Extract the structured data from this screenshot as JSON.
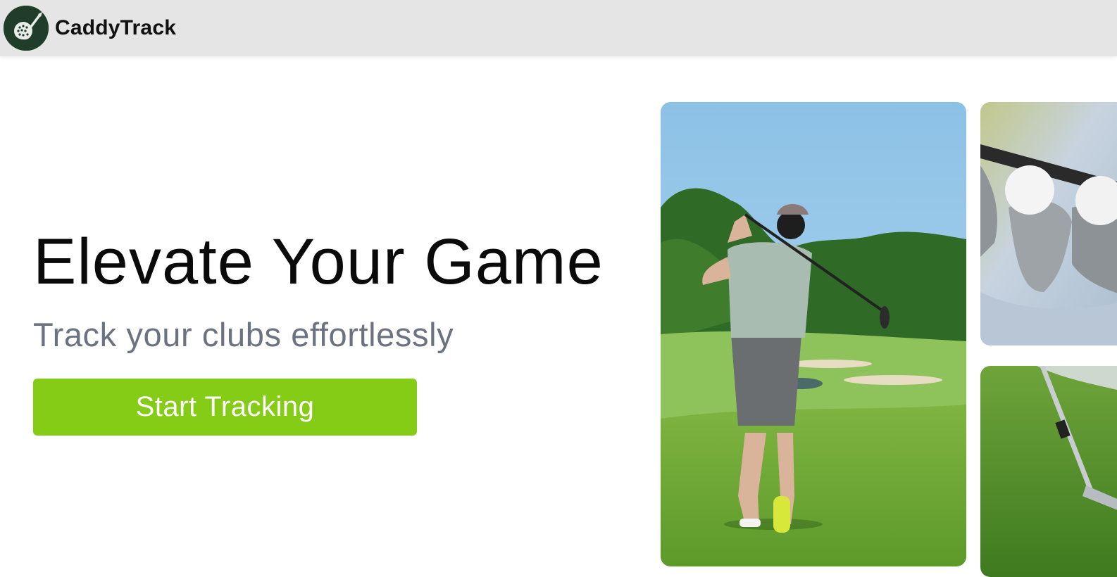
{
  "header": {
    "brand_name": "CaddyTrack",
    "logo_icon": "golf-ball-club-icon"
  },
  "hero": {
    "headline": "Elevate Your Game",
    "subheadline": "Track your clubs effortlessly",
    "cta_label": "Start Tracking"
  },
  "gallery": {
    "images": [
      {
        "subject": "golfer-swinging-on-course"
      },
      {
        "subject": "golf-balls-on-irons"
      },
      {
        "subject": "iron-club-on-grass"
      }
    ]
  },
  "colors": {
    "header_bg": "#e5e5e5",
    "logo_bg": "#1f3d28",
    "cta_bg": "#84cc16",
    "subheadline": "#6b7280"
  }
}
